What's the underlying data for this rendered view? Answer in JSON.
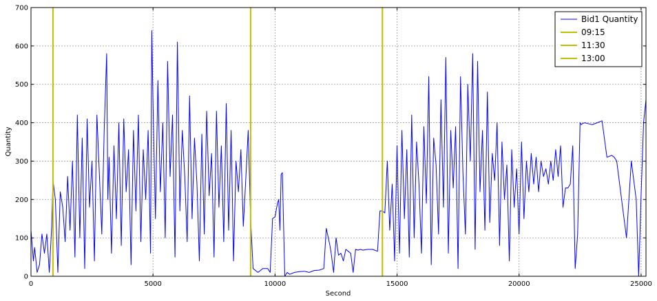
{
  "chart_data": {
    "type": "line",
    "title": "",
    "xlabel": "Second",
    "ylabel": "Quantity",
    "xlim": [
      0,
      25200
    ],
    "ylim": [
      0,
      700
    ],
    "xticks": [
      0,
      5000,
      10000,
      15000,
      20000,
      25000
    ],
    "yticks": [
      0,
      100,
      200,
      300,
      400,
      500,
      600,
      700
    ],
    "grid": true,
    "legend_position": "top-right",
    "colors": {
      "series": "#0000ff",
      "vlines": "#bfbf00"
    },
    "series": [
      {
        "name": "Bid1 Quantity",
        "x": [
          0,
          100,
          150,
          250,
          350,
          450,
          550,
          650,
          750,
          850,
          900,
          1000,
          1100,
          1200,
          1300,
          1400,
          1500,
          1600,
          1700,
          1800,
          1900,
          2000,
          2100,
          2200,
          2300,
          2400,
          2500,
          2600,
          2700,
          2800,
          2900,
          3000,
          3100,
          3150,
          3200,
          3300,
          3400,
          3500,
          3600,
          3700,
          3800,
          3900,
          4000,
          4100,
          4200,
          4300,
          4400,
          4500,
          4600,
          4700,
          4800,
          4900,
          4950,
          5000,
          5100,
          5200,
          5300,
          5400,
          5500,
          5600,
          5700,
          5800,
          5900,
          6000,
          6100,
          6200,
          6300,
          6400,
          6500,
          6600,
          6700,
          6800,
          6900,
          7000,
          7100,
          7200,
          7300,
          7400,
          7500,
          7600,
          7700,
          7800,
          7900,
          8000,
          8100,
          8200,
          8300,
          8400,
          8500,
          8600,
          8700,
          8800,
          8900,
          9000,
          9100,
          9300,
          9500,
          9700,
          9800,
          9900,
          10000,
          10100,
          10150,
          10200,
          10250,
          10300,
          10400,
          10500,
          10600,
          10800,
          11000,
          11200,
          11400,
          11600,
          11800,
          12000,
          12100,
          12200,
          12250,
          12300,
          12400,
          12500,
          12600,
          12700,
          12800,
          12900,
          13000,
          13100,
          13200,
          13300,
          13400,
          13500,
          13600,
          13800,
          14000,
          14200,
          14300,
          14400,
          14500,
          14600,
          14700,
          14800,
          14900,
          15000,
          15100,
          15200,
          15300,
          15400,
          15500,
          15600,
          15700,
          15800,
          15900,
          16000,
          16100,
          16200,
          16300,
          16400,
          16500,
          16600,
          16700,
          16800,
          16900,
          17000,
          17100,
          17200,
          17300,
          17400,
          17500,
          17600,
          17700,
          17800,
          17900,
          18000,
          18100,
          18200,
          18300,
          18400,
          18500,
          18600,
          18700,
          18800,
          18900,
          19000,
          19100,
          19200,
          19300,
          19400,
          19500,
          19600,
          19700,
          19800,
          19900,
          20000,
          20100,
          20200,
          20300,
          20400,
          20500,
          20600,
          20700,
          20800,
          20900,
          21000,
          21100,
          21200,
          21300,
          21400,
          21500,
          21600,
          21700,
          21800,
          21900,
          22000,
          22100,
          22200,
          22300,
          22400,
          22500,
          22550,
          22600,
          22700,
          22800,
          23000,
          23200,
          23400,
          23600,
          23800,
          23900,
          24000,
          24200,
          24400,
          24600,
          24800,
          24900,
          25000,
          25100,
          25200
        ],
        "y": [
          120,
          40,
          75,
          10,
          30,
          110,
          60,
          110,
          10,
          130,
          250,
          200,
          10,
          220,
          180,
          90,
          260,
          120,
          300,
          50,
          420,
          100,
          360,
          20,
          410,
          180,
          300,
          40,
          420,
          270,
          110,
          380,
          580,
          200,
          310,
          60,
          340,
          150,
          400,
          80,
          410,
          220,
          330,
          30,
          380,
          170,
          420,
          90,
          330,
          200,
          380,
          60,
          640,
          450,
          150,
          510,
          220,
          400,
          100,
          560,
          260,
          420,
          50,
          610,
          170,
          380,
          260,
          90,
          470,
          150,
          360,
          240,
          40,
          370,
          110,
          430,
          210,
          320,
          50,
          430,
          180,
          340,
          90,
          450,
          120,
          380,
          40,
          300,
          220,
          330,
          130,
          250,
          380,
          150,
          20,
          10,
          20,
          20,
          10,
          150,
          155,
          190,
          200,
          120,
          265,
          270,
          0,
          10,
          5,
          10,
          12,
          13,
          10,
          15,
          16,
          20,
          125,
          95,
          80,
          60,
          10,
          100,
          55,
          60,
          40,
          70,
          65,
          60,
          10,
          70,
          68,
          70,
          68,
          70,
          70,
          65,
          170,
          170,
          165,
          300,
          120,
          240,
          40,
          340,
          60,
          380,
          150,
          330,
          50,
          420,
          100,
          350,
          240,
          60,
          390,
          190,
          520,
          30,
          360,
          290,
          110,
          460,
          180,
          570,
          60,
          380,
          230,
          390,
          20,
          520,
          270,
          110,
          500,
          300,
          580,
          70,
          560,
          220,
          380,
          120,
          480,
          140,
          320,
          250,
          400,
          80,
          350,
          200,
          290,
          40,
          330,
          180,
          280,
          110,
          350,
          150,
          300,
          220,
          320,
          240,
          310,
          220,
          300,
          260,
          280,
          240,
          300,
          250,
          330,
          260,
          340,
          180,
          230,
          230,
          240,
          340,
          20,
          110,
          400,
          395,
          398,
          400,
          398,
          395,
          400,
          405,
          310,
          315,
          310,
          300,
          200,
          100,
          300,
          200,
          0,
          210,
          400,
          460
        ]
      }
    ],
    "vlines": [
      {
        "name": "09:15",
        "x": 900
      },
      {
        "name": "11:30",
        "x": 9000
      },
      {
        "name": "13:00",
        "x": 14400
      }
    ]
  }
}
